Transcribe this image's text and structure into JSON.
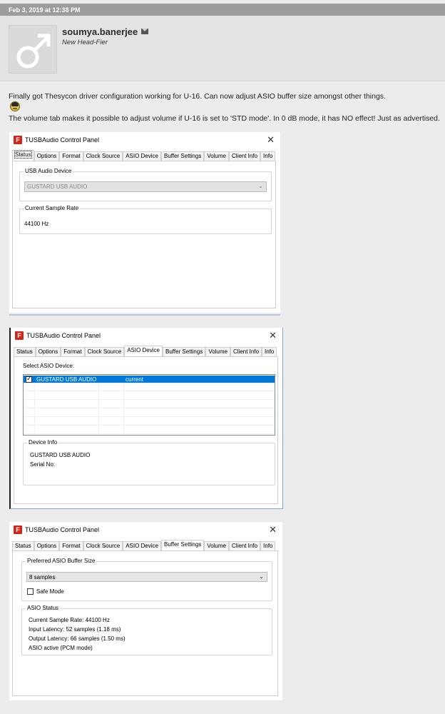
{
  "post": {
    "date": "Feb 3, 2019 at 12:38 PM",
    "username": "soumya.banerjee",
    "user_title": "New Head-Fier",
    "avatar_icon": "male-symbol-icon",
    "line1": "Finally got Thesycon driver configuration working for U-16. Can now adjust ASIO buffer size amongst other things.",
    "emoji_icon": "nerd-face-icon",
    "line2": "The volume tab makes it possible to adjust volume if U-16 is set to 'STD mode'. In 0 dB mode, it has NO effect! Just as advertised."
  },
  "window_title": "TUSBAudio Control Panel",
  "app_icon_letter": "F",
  "close_glyph": "✕",
  "tabs": [
    "Status",
    "Options",
    "Format",
    "Clock Source",
    "ASIO Device",
    "Buffer Settings",
    "Volume",
    "Client Info",
    "Info"
  ],
  "status_panel": {
    "usb_device_label": "USB Audio Device",
    "usb_device_value": "GUSTARD USB AUDIO",
    "sample_rate_label": "Current Sample Rate",
    "sample_rate_value": "44100 Hz"
  },
  "asio_panel": {
    "select_label": "Select ASIO Device:",
    "device_name": "GUSTARD USB AUDIO",
    "device_state": "current",
    "device_checked": true,
    "info_label": "Device Info",
    "info_name": "GUSTARD USB AUDIO",
    "serial_label": "Serial No:"
  },
  "buffer_panel": {
    "preferred_label": "Preferred ASIO Buffer Size",
    "buffer_value": "8 samples",
    "safe_mode_label": "Safe Mode",
    "safe_mode_checked": false,
    "status_label": "ASIO Status",
    "status_lines": [
      "Current Sample Rate: 44100 Hz",
      "Input Latency: 52 samples (1.18 ms)",
      "Output Latency: 66 samples (1.50 ms)",
      "ASIO active (PCM mode)"
    ]
  }
}
